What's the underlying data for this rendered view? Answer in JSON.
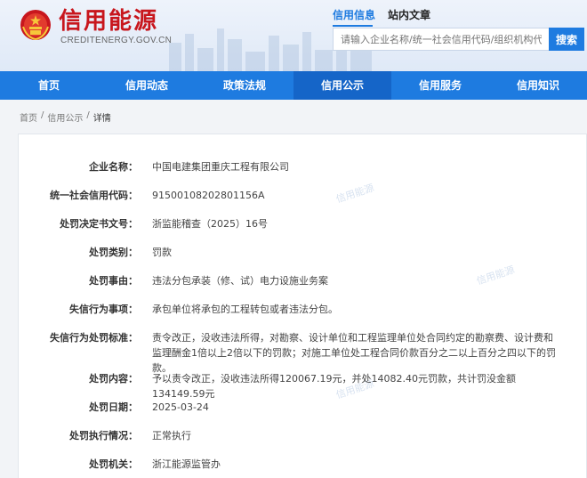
{
  "site": {
    "title": "信用能源",
    "domain": "CREDITENERGY.GOV.CN"
  },
  "search": {
    "tabs": [
      "信用信息",
      "站内文章"
    ],
    "placeholder": "请输入企业名称/统一社会信用代码/组织机构代码",
    "button_label": "搜索"
  },
  "nav": {
    "items": [
      "首页",
      "信用动态",
      "政策法规",
      "信用公示",
      "信用服务",
      "信用知识"
    ],
    "active_index": 3
  },
  "breadcrumb": [
    "首页",
    "信用公示",
    "详情"
  ],
  "detail": {
    "fields": [
      {
        "label": "企业名称：",
        "value": "中国电建集团重庆工程有限公司"
      },
      {
        "label": "统一社会信用代码：",
        "value": "91500108202801156A"
      },
      {
        "label": "处罚决定书文号：",
        "value": "浙监能稽查（2025）16号"
      },
      {
        "label": "处罚类别：",
        "value": "罚款"
      },
      {
        "label": "处罚事由：",
        "value": "违法分包承装（修、试）电力设施业务案"
      },
      {
        "label": "失信行为事项：",
        "value": "承包单位将承包的工程转包或者违法分包。"
      },
      {
        "label": "失信行为处罚标准：",
        "value": "责令改正，没收违法所得，对勘察、设计单位和工程监理单位处合同约定的勘察费、设计费和监理酬金1倍以上2倍以下的罚款；对施工单位处工程合同价款百分之二以上百分之四以下的罚款。"
      },
      {
        "label": "处罚内容：",
        "value": "予以责令改正，没收违法所得120067.19元，并处14082.40元罚款，共计罚没金额134149.59元"
      },
      {
        "label": "处罚日期：",
        "value": "2025-03-24"
      },
      {
        "label": "处罚执行情况：",
        "value": "正常执行"
      },
      {
        "label": "处罚机关：",
        "value": "浙江能源监管办"
      }
    ]
  },
  "watermark_text": "信用能源",
  "colors": {
    "brand_red": "#c8161d",
    "nav_blue": "#1e7be0",
    "nav_active": "#1565c8"
  }
}
